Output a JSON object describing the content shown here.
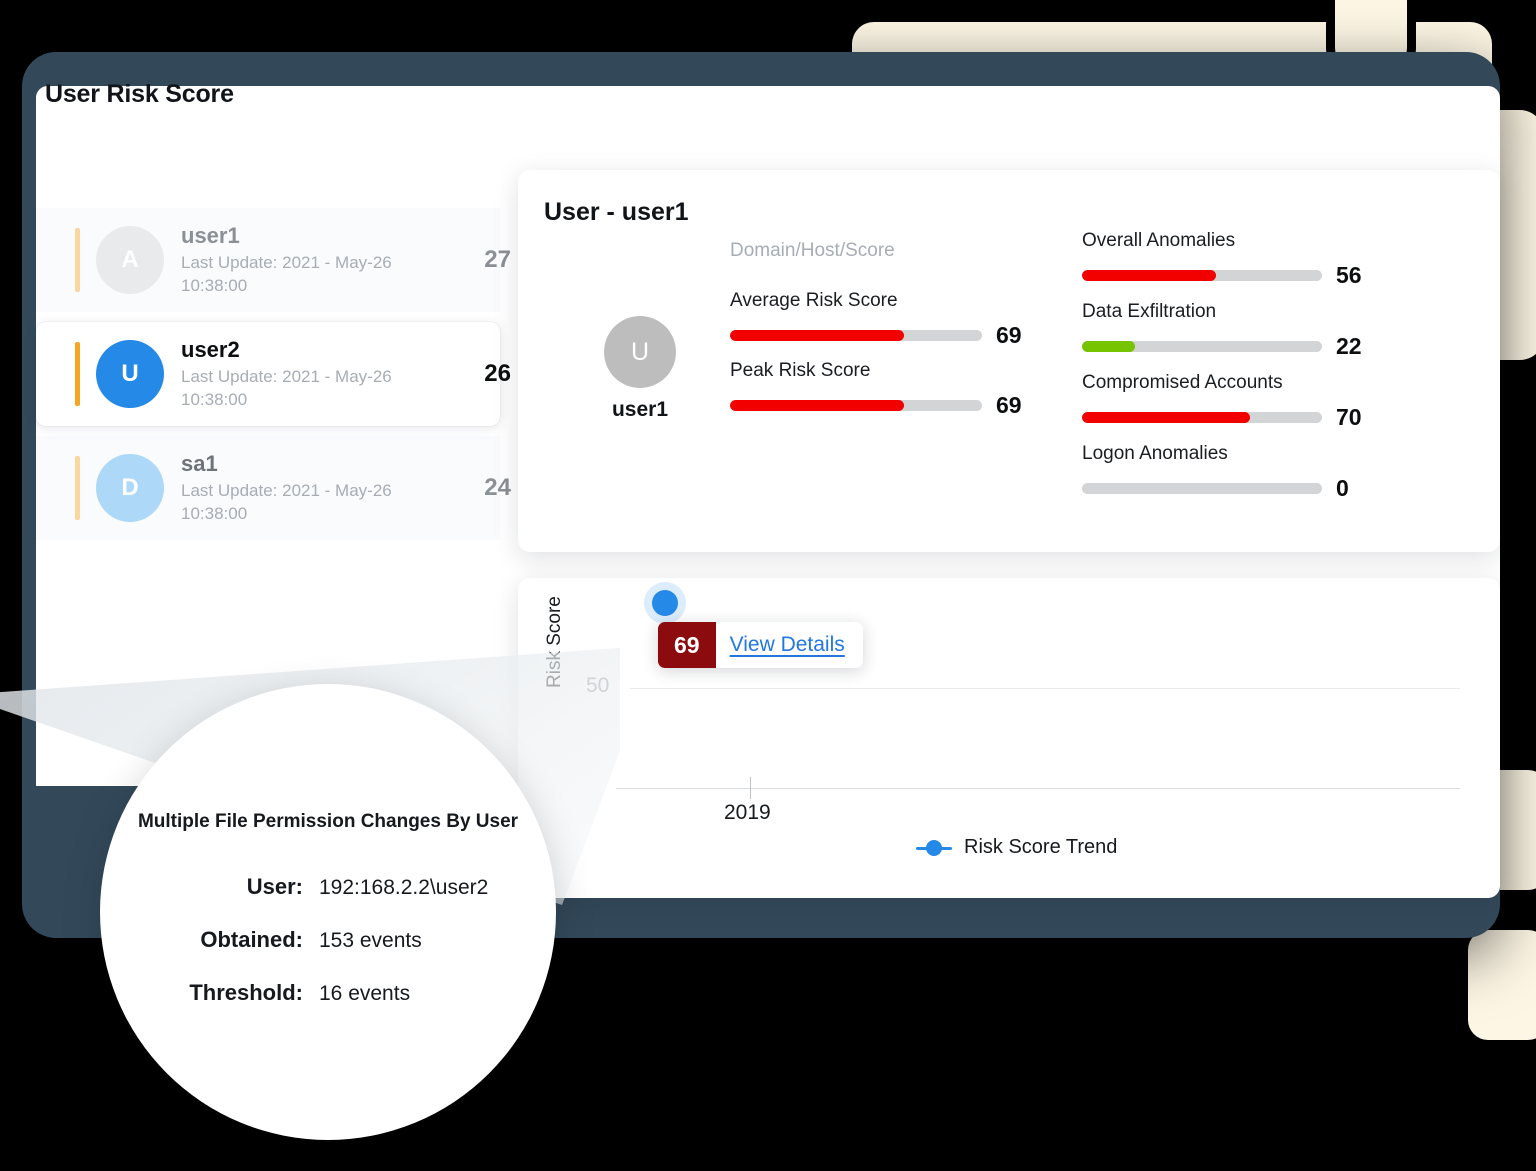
{
  "theme": {
    "frame_color": "#33495A",
    "deco_color": "#FDF6E4",
    "accent_blue": "#2589E8",
    "danger_red": "#F20000",
    "safe_green": "#76C300",
    "badge_dark_red": "#8C0B0E",
    "track_gray": "#D2D4D6",
    "orange_accent": "#F5A623"
  },
  "risk_list": {
    "title": "User Risk Score",
    "users": [
      {
        "name": "user1",
        "subtitle": "Last Update: 2021 - May-26 10:38:00",
        "score": "27",
        "avatar_letter": "A",
        "avatar_color": "#E8EAEC",
        "avatar_text_color": "#FFFFFF",
        "accent_color": "#FAD7A0",
        "name_color": "#8A9096",
        "score_color": "#8A9096",
        "selected": false
      },
      {
        "name": "user2",
        "subtitle": "Last Update: 2021 - May-26 10:38:00",
        "score": "26",
        "avatar_letter": "U",
        "avatar_color": "#2589E8",
        "avatar_text_color": "#FFFFFF",
        "accent_color": "#F5A623",
        "name_color": "#0C0E10",
        "score_color": "#0C0E10",
        "selected": true
      },
      {
        "name": "sa1",
        "subtitle": "Last Update: 2021 - May-26 10:38:00",
        "score": "24",
        "avatar_letter": "D",
        "avatar_color": "#ADD8F7",
        "avatar_text_color": "#FFFFFF",
        "accent_color": "#FAD7A0",
        "name_color": "#6E747A",
        "score_color": "#8A9096",
        "selected": false
      }
    ]
  },
  "detail_card": {
    "title": "User - user1",
    "avatar_letter": "U",
    "avatar_name": "user1",
    "section_label": "Domain/Host/Score",
    "left_metrics": [
      {
        "label": "Average Risk Score",
        "value": "69",
        "percent": 69,
        "color": "#F20000"
      },
      {
        "label": "Peak Risk Score",
        "value": "69",
        "percent": 69,
        "color": "#F20000"
      }
    ],
    "right_metrics": [
      {
        "label": "Overall Anomalies",
        "value": "56",
        "percent": 56,
        "color": "#F20000"
      },
      {
        "label": "Data Exfiltration",
        "value": "22",
        "percent": 22,
        "color": "#76C300"
      },
      {
        "label": "Compromised Accounts",
        "value": "70",
        "percent": 70,
        "color": "#F20000"
      },
      {
        "label": "Logon Anomalies",
        "value": "0",
        "percent": 0,
        "color": "#F20000"
      }
    ]
  },
  "chart_card": {
    "tooltip_score": "69",
    "tooltip_link": "View Details"
  },
  "chart_data": {
    "type": "line",
    "title": "",
    "xlabel": "",
    "ylabel": "Risk Score",
    "x": [
      "2019"
    ],
    "xticklabels": [
      "2019"
    ],
    "yticklabels": [
      "50"
    ],
    "ylim": [
      0,
      75
    ],
    "grid": true,
    "legend_position": "bottom",
    "series": [
      {
        "name": "Risk Score Trend",
        "color": "#2589E8",
        "points": [
          {
            "x": "2019",
            "y": 69,
            "label": "69"
          }
        ]
      }
    ],
    "annotations": [
      {
        "type": "tooltip",
        "score": "69",
        "link": "View Details",
        "at_x": "2019",
        "at_y": 69
      }
    ]
  },
  "magnifier": {
    "title": "Multiple File Permission Changes By User",
    "rows": [
      {
        "key": "User:",
        "value": "192:168.2.2\\user2"
      },
      {
        "key": "Obtained:",
        "value": "153 events"
      },
      {
        "key": "Threshold:",
        "value": "16 events"
      }
    ]
  }
}
